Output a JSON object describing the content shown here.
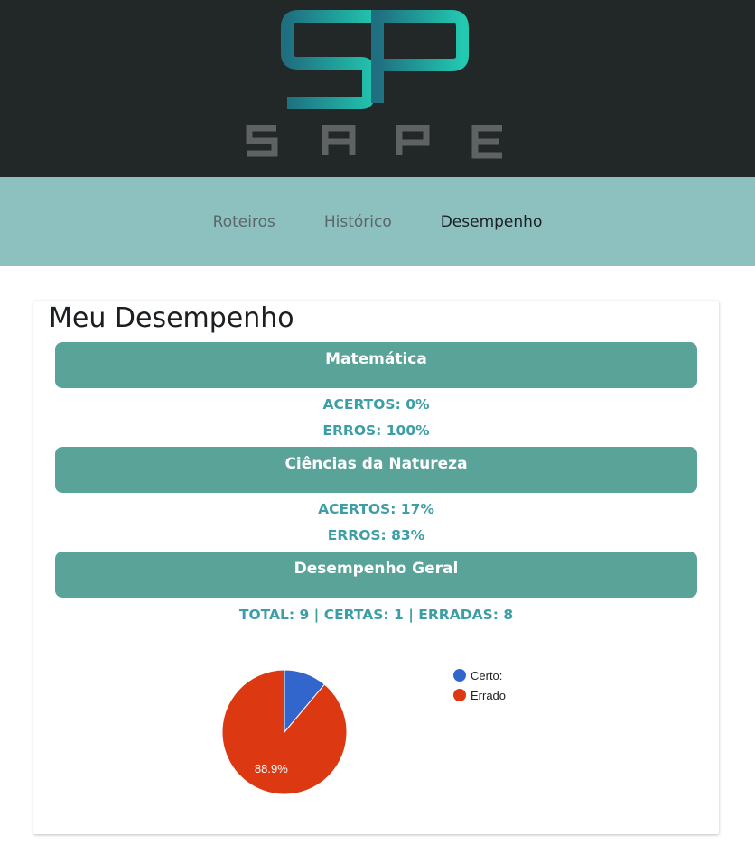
{
  "brand": {
    "logo_text": "SAPE",
    "logo_initials": "SP"
  },
  "nav": {
    "items": [
      {
        "label": "Roteiros"
      },
      {
        "label": "Histórico"
      },
      {
        "label": "Desempenho"
      }
    ],
    "active": "Desempenho"
  },
  "main": {
    "title": "Meu Desempenho",
    "subjects": [
      {
        "name": "Matemática",
        "line1": "ACERTOS: 0%",
        "line2": "ERROS: 100%"
      },
      {
        "name": "Ciências da Natureza",
        "line1": "ACERTOS: 17%",
        "line2": "ERROS: 83%"
      },
      {
        "name": "Desempenho Geral",
        "line1": "TOTAL: 9 | CERTAS: 1 | ERRADAS: 8"
      }
    ]
  },
  "colors": {
    "header_bg": "#222728",
    "nav_bg": "#8dc1c0",
    "subject_bar": "#5aa399",
    "stat_text": "#3d9ea5",
    "certo": "#3366cc",
    "errado": "#dc3912"
  },
  "chart_data": {
    "type": "pie",
    "categories": [
      "Certo:",
      "Errado"
    ],
    "values": [
      1,
      8
    ],
    "data_labels": [
      "",
      "88.9%"
    ],
    "colors": [
      "#3366cc",
      "#dc3912"
    ],
    "legend_position": "right"
  }
}
